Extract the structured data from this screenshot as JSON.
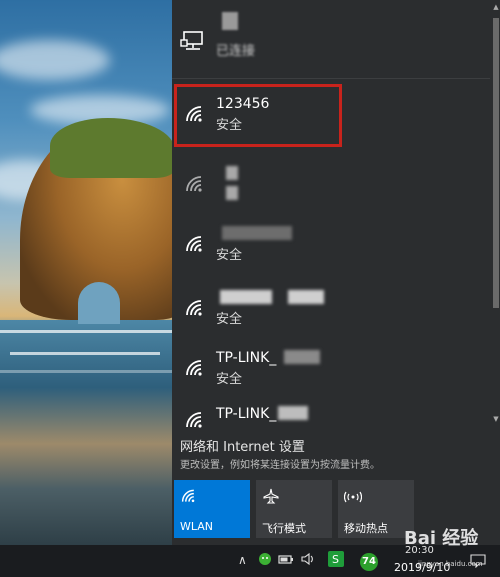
{
  "connected": {
    "status": "已连接"
  },
  "networks": [
    {
      "name": "123456",
      "security": "安全",
      "highlighted": true
    },
    {
      "name": "",
      "security": ""
    },
    {
      "name": "",
      "security": "安全"
    },
    {
      "name": "",
      "security": "安全"
    },
    {
      "name": "TP-LINK_",
      "security": "安全"
    },
    {
      "name": "TP-LINK_",
      "security": ""
    }
  ],
  "settings": {
    "link": "网络和 Internet 设置",
    "description": "更改设置，例如将某连接设置为按流量计费。"
  },
  "quick_actions": [
    {
      "label": "WLAN",
      "icon": "wifi-icon",
      "active": true
    },
    {
      "label": "飞行模式",
      "icon": "airplane-icon",
      "active": false
    },
    {
      "label": "移动热点",
      "icon": "hotspot-icon",
      "active": false
    }
  ],
  "taskbar": {
    "badge": "74",
    "time": "20:30",
    "date": "2019/9/10"
  },
  "watermark": {
    "text": "Bai 经验",
    "sub": "jingyan.baidu.com"
  },
  "colors": {
    "accent": "#0078d7",
    "highlight_border": "#c8231c",
    "panel_bg": "#2b2d2f"
  }
}
